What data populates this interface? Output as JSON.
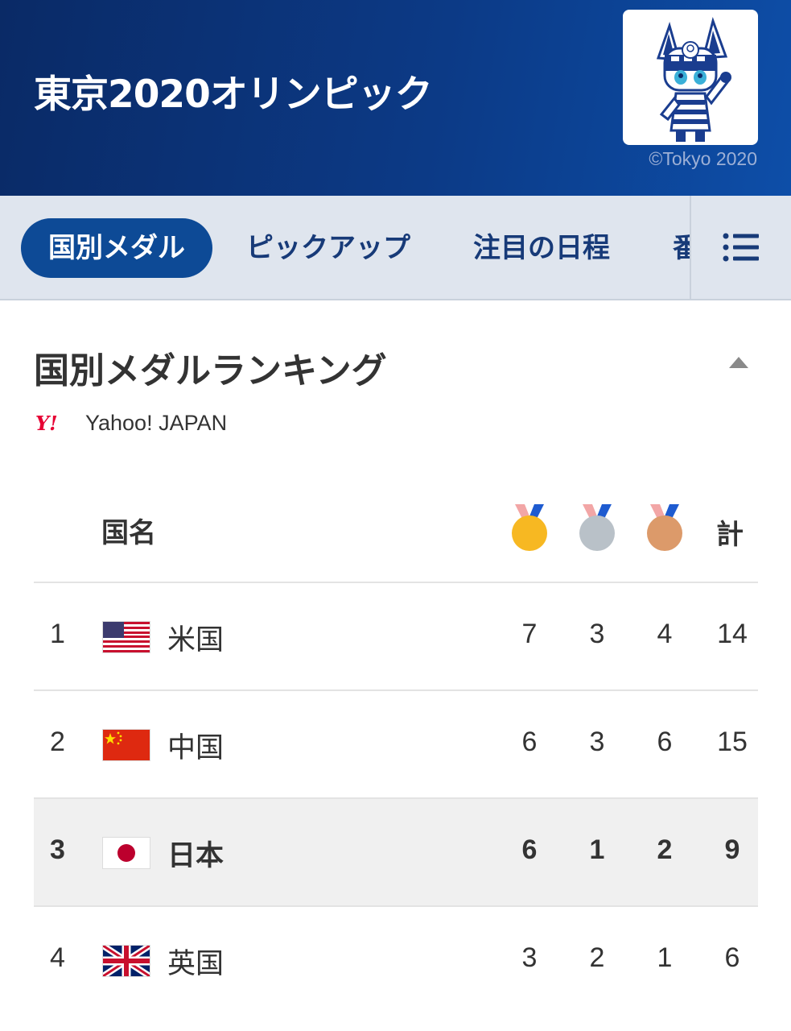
{
  "header": {
    "title": "東京2020オリンピック",
    "copyright": "©Tokyo 2020",
    "mascot_icon": "miraitowa-mascot"
  },
  "tabs": [
    {
      "label": "国別メダル",
      "active": true
    },
    {
      "label": "ピックアップ",
      "active": false
    },
    {
      "label": "注目の日程",
      "active": false
    },
    {
      "label": "番",
      "active": false
    }
  ],
  "menu_icon": "list-menu-icon",
  "section": {
    "title": "国別メダルランキング",
    "source": "Yahoo! JAPAN",
    "collapse_icon": "triangle-up-icon"
  },
  "table": {
    "header": {
      "country": "国名",
      "total": "計",
      "medal_icons": [
        "gold-medal-icon",
        "silver-medal-icon",
        "bronze-medal-icon"
      ]
    },
    "rows": [
      {
        "rank": "1",
        "flag": "usa-flag",
        "country": "米国",
        "gold": "7",
        "silver": "3",
        "bronze": "4",
        "total": "14"
      },
      {
        "rank": "2",
        "flag": "china-flag",
        "country": "中国",
        "gold": "6",
        "silver": "3",
        "bronze": "6",
        "total": "15"
      },
      {
        "rank": "3",
        "flag": "japan-flag",
        "country": "日本",
        "gold": "6",
        "silver": "1",
        "bronze": "2",
        "total": "9"
      },
      {
        "rank": "4",
        "flag": "uk-flag",
        "country": "英国",
        "gold": "3",
        "silver": "2",
        "bronze": "1",
        "total": "6"
      }
    ]
  },
  "colors": {
    "header_bg": "#0c3a86",
    "tab_active": "#0d4a96",
    "tab_text": "#173a78",
    "tabbar_bg": "#dfe5ee",
    "gold": "#f7b822",
    "silver": "#b9c1c8",
    "bronze": "#dc9a6a",
    "highlight_row": "#f0f0f0"
  }
}
